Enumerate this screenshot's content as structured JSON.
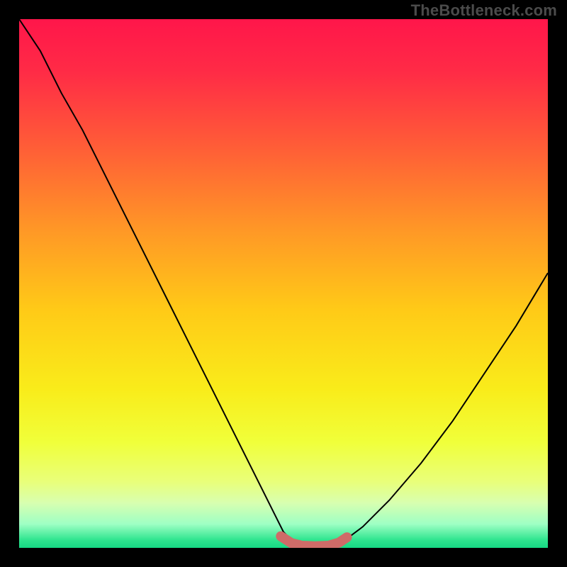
{
  "watermark": "TheBottleneck.com",
  "colors": {
    "background": "#000000",
    "gradient_stops": [
      {
        "offset": 0.0,
        "color": "#ff164a"
      },
      {
        "offset": 0.1,
        "color": "#ff2b46"
      },
      {
        "offset": 0.25,
        "color": "#ff6036"
      },
      {
        "offset": 0.4,
        "color": "#ff9826"
      },
      {
        "offset": 0.55,
        "color": "#ffca17"
      },
      {
        "offset": 0.7,
        "color": "#f9ec1a"
      },
      {
        "offset": 0.8,
        "color": "#f0ff3a"
      },
      {
        "offset": 0.875,
        "color": "#e9ff7a"
      },
      {
        "offset": 0.915,
        "color": "#d8ffb0"
      },
      {
        "offset": 0.955,
        "color": "#9effc4"
      },
      {
        "offset": 0.985,
        "color": "#2fe58f"
      },
      {
        "offset": 1.0,
        "color": "#16d884"
      }
    ],
    "curve": "#000000",
    "marker": "#cf6b68"
  },
  "chart_data": {
    "type": "line",
    "title": "",
    "xlabel": "",
    "ylabel": "",
    "xlim": [
      0,
      100
    ],
    "ylim": [
      0,
      100
    ],
    "grid": false,
    "legend": false,
    "series": [
      {
        "name": "bottleneck-curve",
        "x": [
          0,
          4,
          8,
          12,
          16,
          20,
          24,
          28,
          32,
          36,
          40,
          44,
          48,
          50,
          52,
          55,
          58,
          61,
          65,
          70,
          76,
          82,
          88,
          94,
          100
        ],
        "y": [
          100,
          94,
          86,
          79,
          71,
          63,
          55,
          47,
          39,
          31,
          23,
          15,
          7,
          3,
          1,
          0,
          0,
          1,
          4,
          9,
          16,
          24,
          33,
          42,
          52
        ]
      }
    ],
    "markers": {
      "name": "optimal-range",
      "x": [
        49.5,
        51.5,
        53.5,
        56.0,
        58.5,
        60.5,
        62.0
      ],
      "y": [
        2.2,
        0.9,
        0.4,
        0.3,
        0.4,
        1.0,
        2.0
      ]
    }
  }
}
